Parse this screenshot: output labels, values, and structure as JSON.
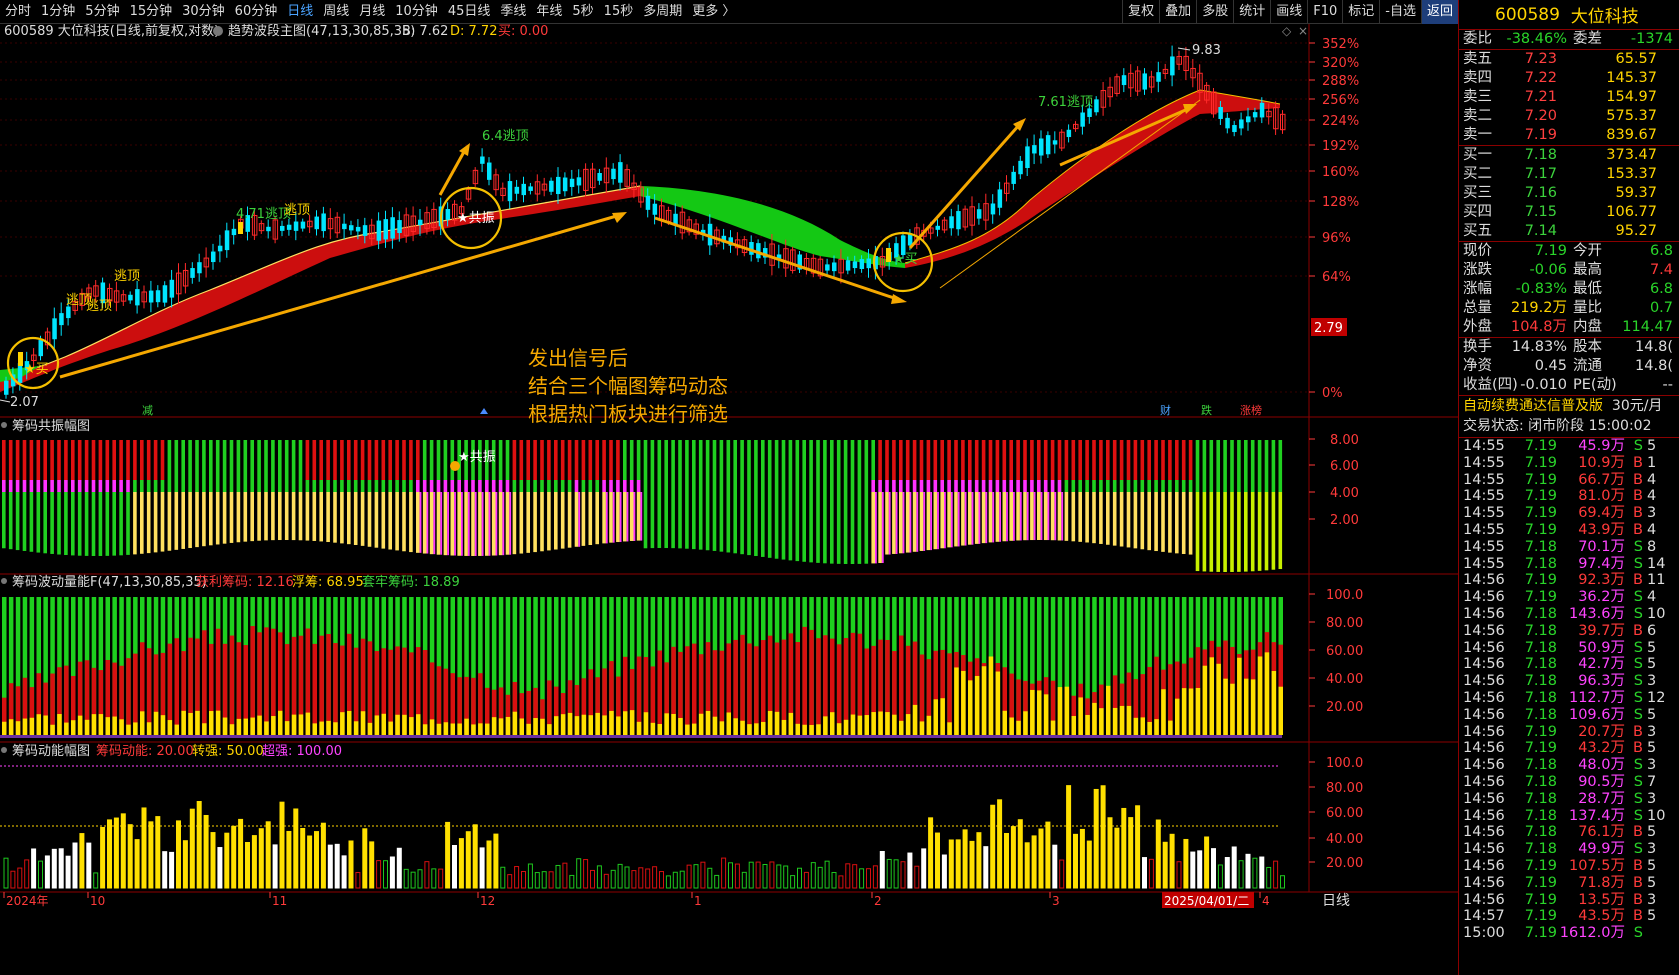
{
  "toolbar": {
    "periods": [
      "分时",
      "1分钟",
      "5分钟",
      "15分钟",
      "30分钟",
      "60分钟",
      "日线",
      "周线",
      "月线",
      "10分钟",
      "45日线",
      "季线",
      "年线",
      "5秒",
      "15秒",
      "多周期",
      "更多 〉"
    ],
    "active_period": "日线",
    "actions": [
      "复权",
      "叠加",
      "多股",
      "统计",
      "画线",
      "F10",
      "标记",
      "-自选",
      "返回"
    ],
    "highlight_action": "返回"
  },
  "main_chart": {
    "title": "600589 大位科技(日线,前复权,对数)",
    "indicator": "趋势波段主图(47,13,30,85,35)",
    "b_label": "B: 7.62",
    "d_label": "D: 7.72",
    "buy_label": "买: 0.00",
    "y_ticks": [
      "352%",
      "320%",
      "288%",
      "256%",
      "224%",
      "192%",
      "160%",
      "128%",
      "96%",
      "64%",
      "0%"
    ],
    "price_marker": "2.79",
    "high_label": "9.83",
    "low_label": "2.07",
    "signals": [
      "★买",
      "逃顶",
      "逃顶",
      "逃顶",
      "4.71逃顶",
      "逃顶",
      "★共振",
      "6.4逃顶",
      "★买",
      "7.61逃顶"
    ],
    "bottom_tags": [
      "减",
      "财",
      "跌",
      "涨榜"
    ],
    "annotation_lines": [
      "发出信号后",
      "结合三个幅图筹码动态",
      "根据热门板块进行筛选"
    ]
  },
  "panel1": {
    "title": "筹码共振幅图",
    "y_ticks": [
      "8.00",
      "6.00",
      "4.00",
      "2.00"
    ],
    "signal": "★共振"
  },
  "panel2": {
    "title": "筹码波动量能F(47,13,30,85,35)",
    "profit_label": "获利筹码: 12.16",
    "float_label": "浮筹: 68.95",
    "locked_label": "套牢筹码: 18.89",
    "y_ticks": [
      "100.0",
      "80.00",
      "60.00",
      "40.00",
      "20.00"
    ]
  },
  "panel3": {
    "title": "筹码动能幅图",
    "kinetic_label": "筹码动能: 20.00",
    "turn_label": "转强: 50.00",
    "super_label": "超强: 100.00",
    "y_ticks": [
      "100.0",
      "80.00",
      "60.00",
      "40.00",
      "20.00"
    ]
  },
  "xaxis": {
    "labels": [
      "2024年",
      "10",
      "11",
      "12",
      "1",
      "2",
      "3",
      "4"
    ],
    "cursor_date": "2025/04/01/二"
  },
  "quote": {
    "code": "600589",
    "name": "大位科技",
    "wb_label": "委比",
    "wb_value": "-38.46%",
    "wc_label": "委差",
    "wc_value": "-1374",
    "asks": [
      {
        "label": "卖五",
        "flag": "¥",
        "price": "7.23",
        "vol": "65.57"
      },
      {
        "label": "卖四",
        "flag": "",
        "price": "7.22",
        "vol": "145.37"
      },
      {
        "label": "卖三",
        "flag": "",
        "price": "7.21",
        "vol": "154.97"
      },
      {
        "label": "卖二",
        "flag": "",
        "price": "7.20",
        "vol": "575.37"
      },
      {
        "label": "卖一",
        "flag": "",
        "price": "7.19",
        "vol": "839.67"
      }
    ],
    "bids": [
      {
        "label": "买一",
        "price": "7.18",
        "vol": "373.47"
      },
      {
        "label": "买二",
        "price": "7.17",
        "vol": "153.37"
      },
      {
        "label": "买三",
        "price": "7.16",
        "vol": "59.37"
      },
      {
        "label": "买四",
        "price": "7.15",
        "vol": "106.77"
      },
      {
        "label": "买五",
        "price": "7.14",
        "vol": "95.27"
      }
    ],
    "stats": [
      {
        "l1": "现价",
        "v1": "7.19",
        "c1": "grn",
        "l2": "今开",
        "v2": "6.8",
        "c2": "grn"
      },
      {
        "l1": "涨跌",
        "v1": "-0.06",
        "c1": "grn",
        "l2": "最高",
        "v2": "7.4",
        "c2": "red"
      },
      {
        "l1": "涨幅",
        "v1": "-0.83%",
        "c1": "grn",
        "l2": "最低",
        "v2": "6.8",
        "c2": "grn"
      },
      {
        "l1": "总量",
        "v1": "219.2万",
        "c1": "yel",
        "l2": "量比",
        "v2": "0.7",
        "c2": "grn"
      },
      {
        "l1": "外盘",
        "v1": "104.8万",
        "c1": "red",
        "l2": "内盘",
        "v2": "114.47",
        "c2": "grn"
      }
    ],
    "stats2": [
      {
        "l1": "换手",
        "v1": "14.83%",
        "l2": "股本",
        "v2": "14.8("
      },
      {
        "l1": "净资",
        "v1": "0.45",
        "l2": "流通",
        "v2": "14.8("
      },
      {
        "l1": "收益(四)",
        "v1": "-0.010",
        "l2": "PE(动)",
        "v2": "--"
      }
    ],
    "ad_text": "自动续费通达信普及版",
    "ad_price": "30元/月",
    "state_text": "交易状态: 闭市阶段 15:00:02",
    "ticks": [
      {
        "t": "14:55",
        "p": "7.19",
        "v": "45.9万",
        "bs": "S",
        "n": "5"
      },
      {
        "t": "14:55",
        "p": "7.19",
        "v": "10.9万",
        "bs": "B",
        "n": "1"
      },
      {
        "t": "14:55",
        "p": "7.19",
        "v": "66.7万",
        "bs": "B",
        "n": "4"
      },
      {
        "t": "14:55",
        "p": "7.19",
        "v": "81.0万",
        "bs": "B",
        "n": "4"
      },
      {
        "t": "14:55",
        "p": "7.19",
        "v": "69.4万",
        "bs": "B",
        "n": "3"
      },
      {
        "t": "14:55",
        "p": "7.19",
        "v": "43.9万",
        "bs": "B",
        "n": "4"
      },
      {
        "t": "14:55",
        "p": "7.18",
        "v": "70.1万",
        "bs": "S",
        "n": "8"
      },
      {
        "t": "14:55",
        "p": "7.18",
        "v": "97.4万",
        "bs": "S",
        "n": "14"
      },
      {
        "t": "14:56",
        "p": "7.19",
        "v": "92.3万",
        "bs": "B",
        "n": "11"
      },
      {
        "t": "14:56",
        "p": "7.19",
        "v": "36.2万",
        "bs": "S",
        "n": "4"
      },
      {
        "t": "14:56",
        "p": "7.18",
        "v": "143.6万",
        "bs": "S",
        "n": "10"
      },
      {
        "t": "14:56",
        "p": "7.18",
        "v": "39.7万",
        "bs": "B",
        "n": "6"
      },
      {
        "t": "14:56",
        "p": "7.18",
        "v": "50.9万",
        "bs": "S",
        "n": "5"
      },
      {
        "t": "14:56",
        "p": "7.18",
        "v": "42.7万",
        "bs": "S",
        "n": "5"
      },
      {
        "t": "14:56",
        "p": "7.18",
        "v": "96.3万",
        "bs": "S",
        "n": "3"
      },
      {
        "t": "14:56",
        "p": "7.18",
        "v": "112.7万",
        "bs": "S",
        "n": "12"
      },
      {
        "t": "14:56",
        "p": "7.18",
        "v": "109.6万",
        "bs": "S",
        "n": "5"
      },
      {
        "t": "14:56",
        "p": "7.19",
        "v": "20.7万",
        "bs": "B",
        "n": "3"
      },
      {
        "t": "14:56",
        "p": "7.19",
        "v": "43.2万",
        "bs": "B",
        "n": "5"
      },
      {
        "t": "14:56",
        "p": "7.18",
        "v": "48.0万",
        "bs": "S",
        "n": "3"
      },
      {
        "t": "14:56",
        "p": "7.18",
        "v": "90.5万",
        "bs": "S",
        "n": "7"
      },
      {
        "t": "14:56",
        "p": "7.18",
        "v": "28.7万",
        "bs": "S",
        "n": "3"
      },
      {
        "t": "14:56",
        "p": "7.18",
        "v": "137.4万",
        "bs": "S",
        "n": "10"
      },
      {
        "t": "14:56",
        "p": "7.18",
        "v": "76.1万",
        "bs": "B",
        "n": "5"
      },
      {
        "t": "14:56",
        "p": "7.18",
        "v": "49.9万",
        "bs": "S",
        "n": "3"
      },
      {
        "t": "14:56",
        "p": "7.19",
        "v": "107.5万",
        "bs": "B",
        "n": "5"
      },
      {
        "t": "14:56",
        "p": "7.19",
        "v": "71.8万",
        "bs": "B",
        "n": "5"
      },
      {
        "t": "14:56",
        "p": "7.19",
        "v": "13.5万",
        "bs": "B",
        "n": "3"
      },
      {
        "t": "14:57",
        "p": "7.19",
        "v": "43.5万",
        "bs": "B",
        "n": "5"
      },
      {
        "t": "15:00",
        "p": "7.19",
        "v": "1612.0万",
        "bs": "S",
        "n": ""
      }
    ],
    "bottom_tab": "日线"
  },
  "colors": {
    "up": "#ff2020",
    "down": "#1ee01e",
    "accent": "#ffd400",
    "cyan": "#00e5ff",
    "ribbon_red": "#d01010",
    "ribbon_green": "#10c010"
  }
}
